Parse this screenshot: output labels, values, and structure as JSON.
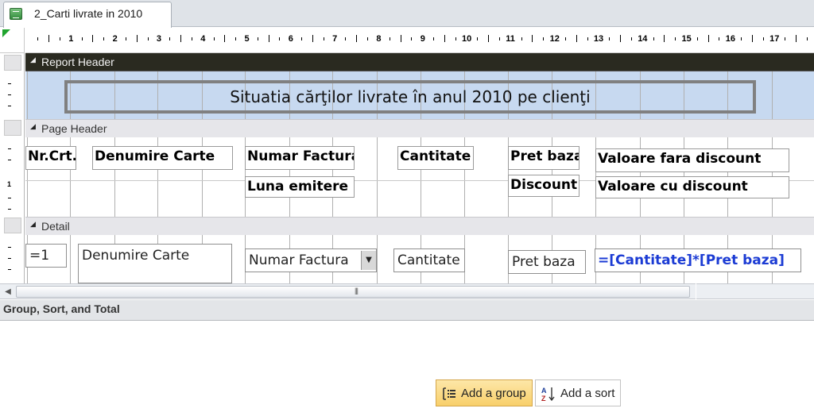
{
  "tab": {
    "title": "2_Carti livrate in 2010",
    "icon": "report-icon"
  },
  "ruler": {
    "numbers": [
      "1",
      "2",
      "3",
      "4",
      "5",
      "6",
      "7",
      "8",
      "9",
      "10",
      "11",
      "12",
      "13",
      "14",
      "15",
      "16",
      "17"
    ]
  },
  "vruler": {
    "marker": "1"
  },
  "sections": {
    "report_header": "Report Header",
    "page_header": "Page Header",
    "detail": "Detail"
  },
  "report_title": "Situatia cărţilor livrate în anul 2010 pe clienţi",
  "page_header_labels": {
    "nr_crt": "Nr.Crt.",
    "denumire_carte": "Denumire Carte",
    "numar_factura": "Numar Factura",
    "luna_emitere": "Luna emitere",
    "cantitate": "Cantitate",
    "pret_baza": "Pret baza",
    "discount": "Discount",
    "valoare_fara_discount": "Valoare fara discount",
    "valoare_cu_discount": "Valoare cu discount"
  },
  "detail_fields": {
    "nr_crt": "=1",
    "denumire_carte": "Denumire Carte",
    "numar_factura": "Numar Factura",
    "cantitate": "Cantitate",
    "pret_baza": "Pret baza",
    "valoare_expr": "=[Cantitate]*[Pret baza]"
  },
  "gst": {
    "title": "Group, Sort, and Total",
    "add_group": "Add a group",
    "add_sort": "Add a sort"
  },
  "colors": {
    "accent_expr": "#1b3bd4",
    "report_header_bar": "#2a2a20",
    "report_header_body": "#c7d9f0"
  }
}
